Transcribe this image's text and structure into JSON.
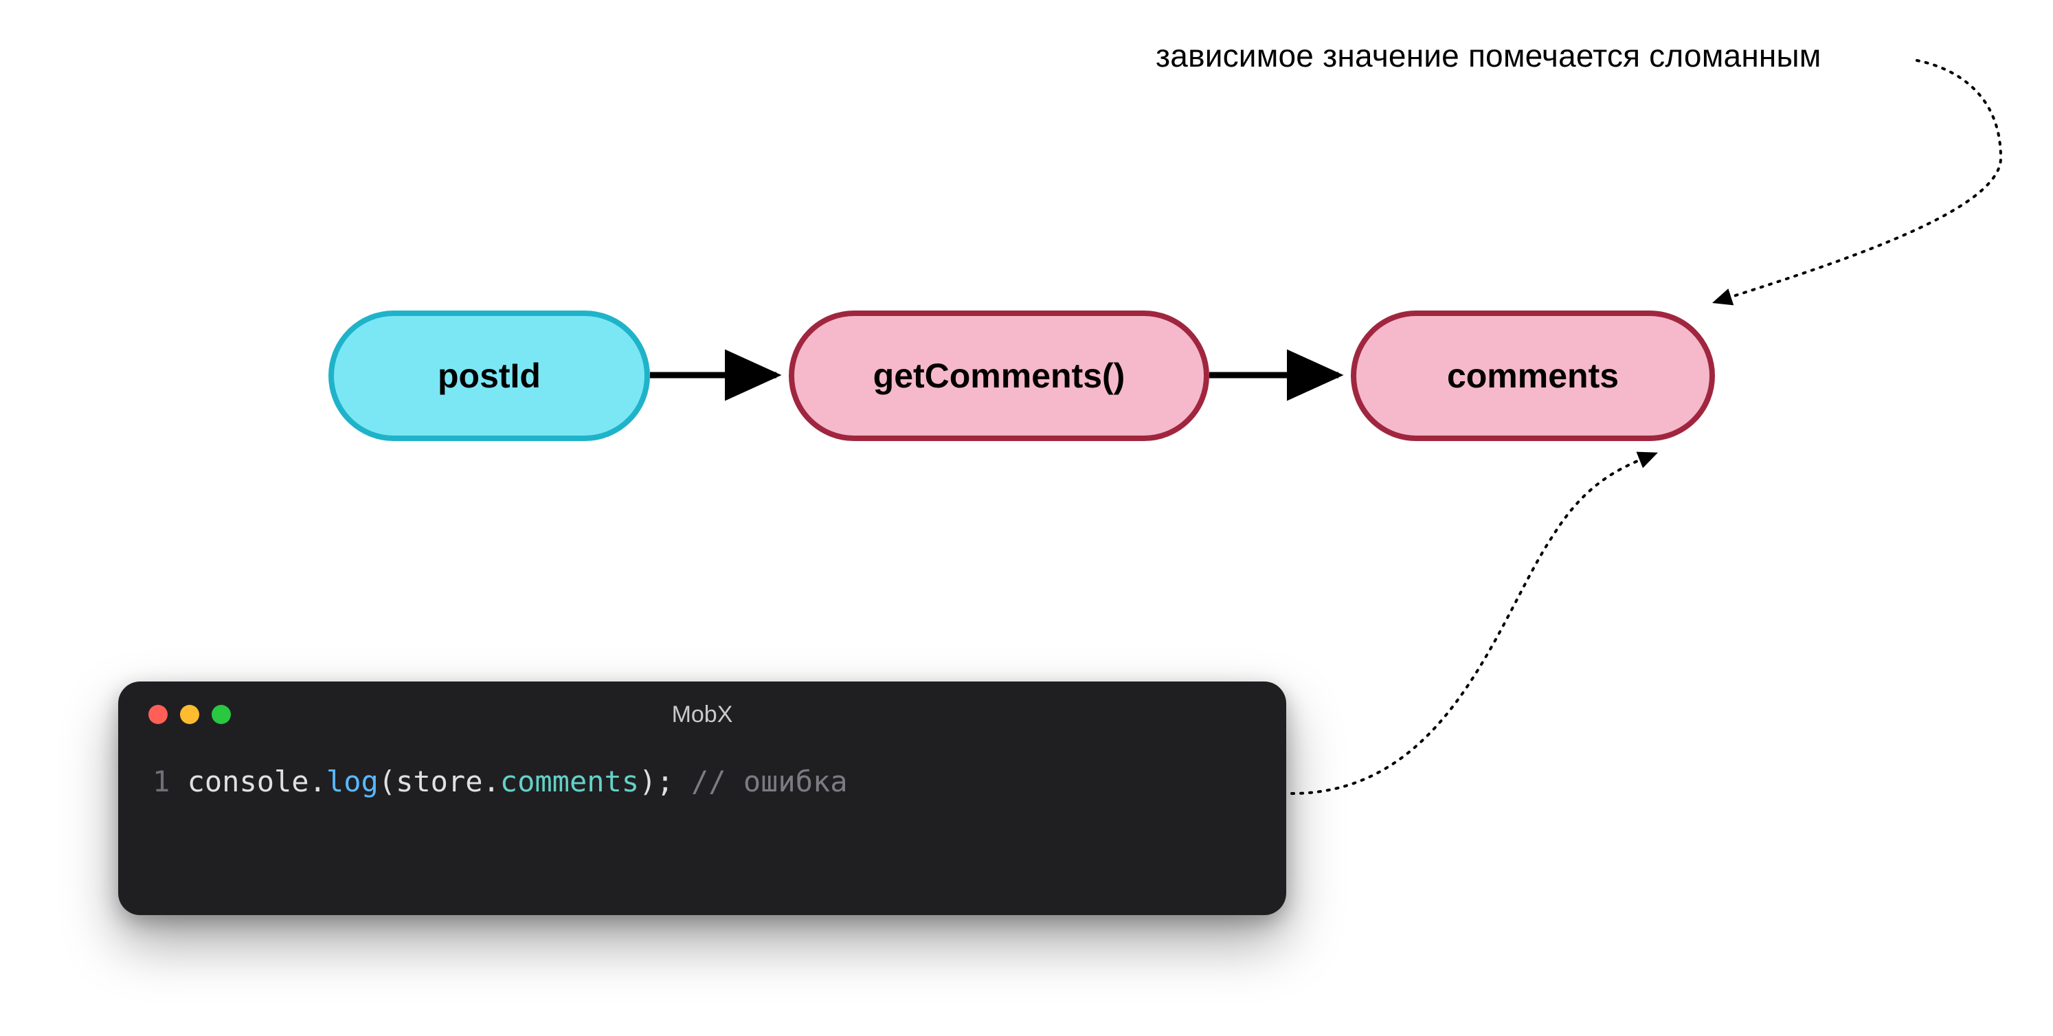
{
  "annotation": {
    "top_label": "зависимое значение помечается сломанным"
  },
  "nodes": {
    "postId": {
      "label": "postId"
    },
    "getComments": {
      "label": "getComments()"
    },
    "comments": {
      "label": "comments"
    }
  },
  "code": {
    "title": "MobX",
    "line_number": "1",
    "tokens": {
      "console": "console",
      "dot1": ".",
      "log": "log",
      "open": "(",
      "store": "store",
      "dot2": ".",
      "comments": "comments",
      "close": ")",
      "semi": ";",
      "space": " ",
      "comment": "// ошибка"
    }
  },
  "colors": {
    "cyan_fill": "#7be7f5",
    "cyan_stroke": "#1fb3c9",
    "pink_fill": "#f5b9cb",
    "pink_stroke": "#a0263f",
    "code_bg": "#1f1f22"
  }
}
